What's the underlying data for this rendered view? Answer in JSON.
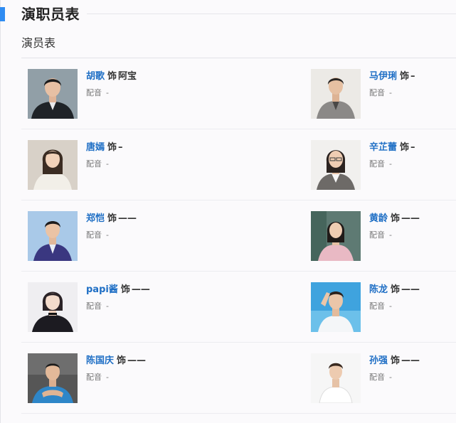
{
  "section": {
    "title": "演职员表",
    "subtitle": "演员表"
  },
  "dub_label": "配音",
  "dub_value": "-",
  "role_word": "饰",
  "cast": [
    {
      "actor": "胡歌",
      "role": "阿宝"
    },
    {
      "actor": "马伊琍",
      "role": "–"
    },
    {
      "actor": "唐嫣",
      "role": "–"
    },
    {
      "actor": "辛芷蕾",
      "role": "–"
    },
    {
      "actor": "郑恺",
      "role": "——"
    },
    {
      "actor": "黄龄",
      "role": "——"
    },
    {
      "actor": "papi酱",
      "role": "——"
    },
    {
      "actor": "陈龙",
      "role": "——"
    },
    {
      "actor": "陈国庆",
      "role": "——"
    },
    {
      "actor": "孙强",
      "role": "——"
    }
  ],
  "colors": {
    "accent": "#2f8cf2",
    "link": "#1f6fc5"
  }
}
